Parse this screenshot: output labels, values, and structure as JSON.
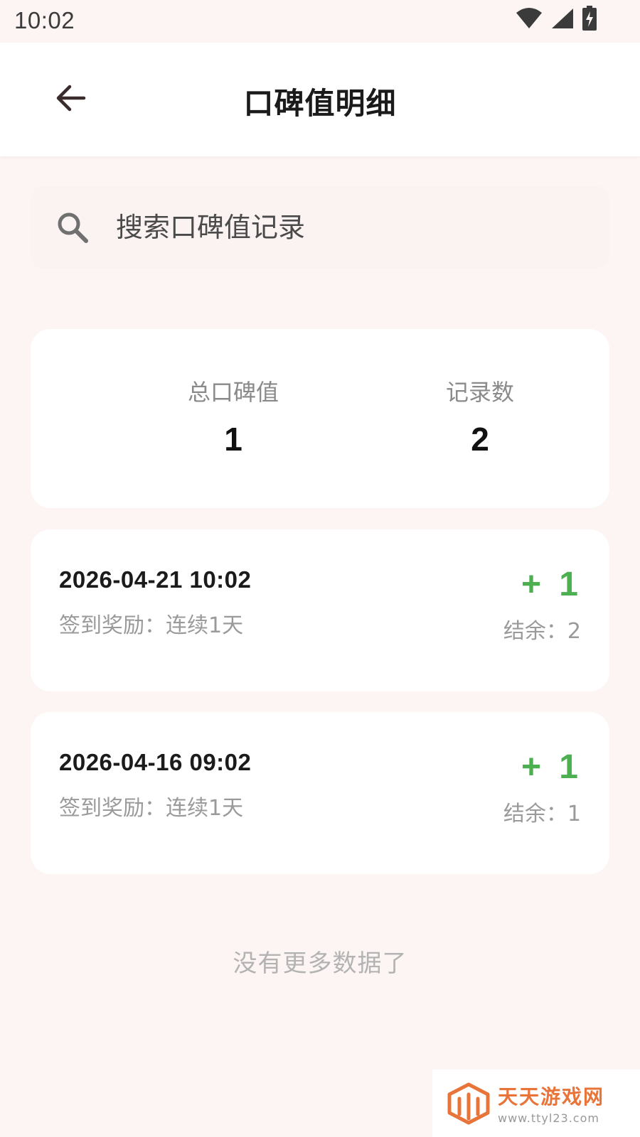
{
  "status_bar": {
    "time": "10:02",
    "icons": [
      "wifi-icon",
      "cellular-signal-icon",
      "battery-charging-icon"
    ]
  },
  "header": {
    "back_icon": "arrow-left-icon",
    "title": "口碑值明细"
  },
  "search": {
    "icon": "search-icon",
    "placeholder": "搜索口碑值记录",
    "value": ""
  },
  "summary": {
    "total_label": "总口碑值",
    "total_value": "1",
    "count_label": "记录数",
    "count_value": "2"
  },
  "records": [
    {
      "date": "2026-04-21 10:02",
      "description": "签到奖励：连续1天",
      "delta": "+ 1",
      "balance": "结余：2"
    },
    {
      "date": "2026-04-16 09:02",
      "description": "签到奖励：连续1天",
      "delta": "+ 1",
      "balance": "结余：1"
    }
  ],
  "footer": {
    "no_more": "没有更多数据了"
  },
  "watermark": {
    "title": "天天游戏网",
    "url": "www.ttyl23.com"
  },
  "colors": {
    "background": "#fcf5f4",
    "positive": "#4caf50",
    "card": "#ffffff",
    "watermark": "#e8743a"
  }
}
